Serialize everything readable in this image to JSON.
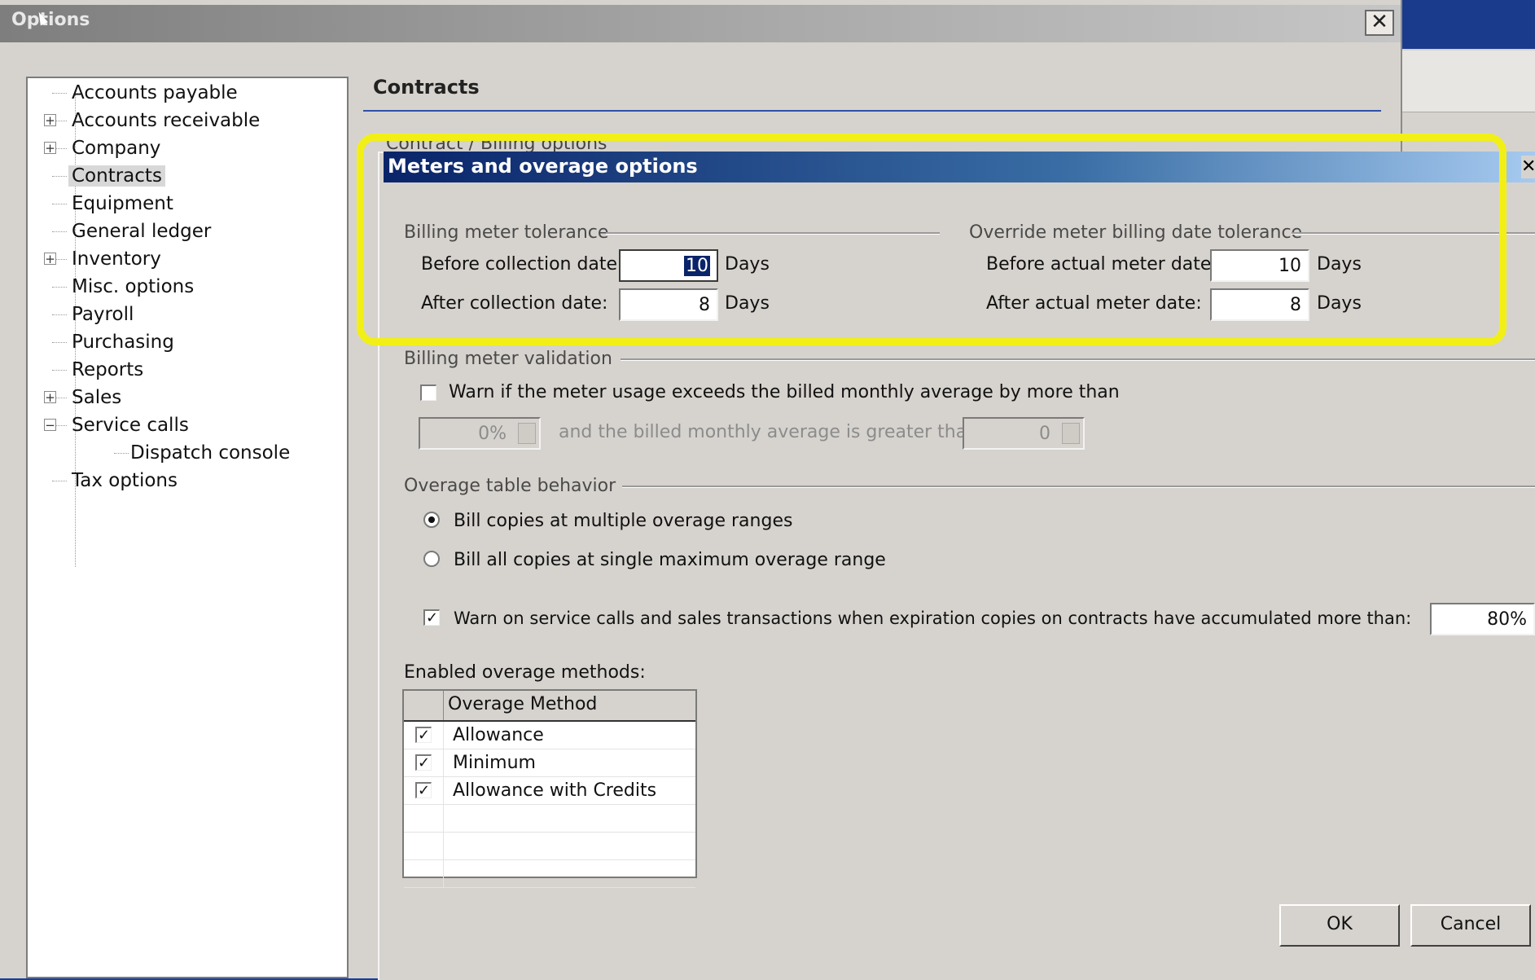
{
  "options_window": {
    "title": "Options",
    "close_glyph": "✕",
    "tree": [
      {
        "label": "Accounts payable",
        "expander": null
      },
      {
        "label": "Accounts receivable",
        "expander": "+"
      },
      {
        "label": "Company",
        "expander": "+"
      },
      {
        "label": "Contracts",
        "expander": null,
        "selected": true
      },
      {
        "label": "Equipment",
        "expander": null
      },
      {
        "label": "General ledger",
        "expander": null
      },
      {
        "label": "Inventory",
        "expander": "+"
      },
      {
        "label": "Misc. options",
        "expander": null
      },
      {
        "label": "Payroll",
        "expander": null
      },
      {
        "label": "Purchasing",
        "expander": null
      },
      {
        "label": "Reports",
        "expander": null
      },
      {
        "label": "Sales",
        "expander": "+"
      },
      {
        "label": "Service calls",
        "expander": "−"
      },
      {
        "label": "Dispatch console",
        "expander": null,
        "child": true
      },
      {
        "label": "Tax options",
        "expander": null
      }
    ],
    "section_title": "Contracts",
    "partially_hidden_group": "Contract / Billing options"
  },
  "meters_dialog": {
    "title": "Meters and overage options",
    "close_glyph": "✕",
    "billing_meter_tolerance": {
      "group_label": "Billing meter tolerance",
      "before_label": "Before collection date:",
      "before_value": "10",
      "after_label": "After collection date:",
      "after_value": "8",
      "unit": "Days"
    },
    "override_tolerance": {
      "group_label": "Override meter billing date tolerance",
      "before_label": "Before actual meter date:",
      "before_value": "10",
      "after_label": "After actual meter date:",
      "after_value": "8",
      "unit": "Days"
    },
    "validation": {
      "group_label": "Billing meter validation",
      "warn_label": "Warn if the meter usage exceeds the billed monthly average by more than",
      "warn_checked": false,
      "percent_value": "0%",
      "and_label": "and the billed monthly average is greater than",
      "average_value": "0"
    },
    "overage_behavior": {
      "group_label": "Overage table behavior",
      "options": [
        {
          "label": "Bill copies at multiple overage ranges",
          "selected": true
        },
        {
          "label": "Bill all copies at single maximum overage range",
          "selected": false
        }
      ]
    },
    "expiration_warning": {
      "label": "Warn on service calls and sales transactions when expiration copies on contracts have accumulated more than:",
      "checked": true,
      "value": "80%"
    },
    "methods": {
      "label": "Enabled overage methods:",
      "column_header": "Overage Method",
      "rows": [
        {
          "label": "Allowance",
          "checked": true
        },
        {
          "label": "Minimum",
          "checked": true
        },
        {
          "label": "Allowance with Credits",
          "checked": true
        }
      ]
    },
    "ok_label": "OK",
    "cancel_label": "Cancel",
    "check_glyph": "✓"
  },
  "highlight_color": "#f2ef16"
}
